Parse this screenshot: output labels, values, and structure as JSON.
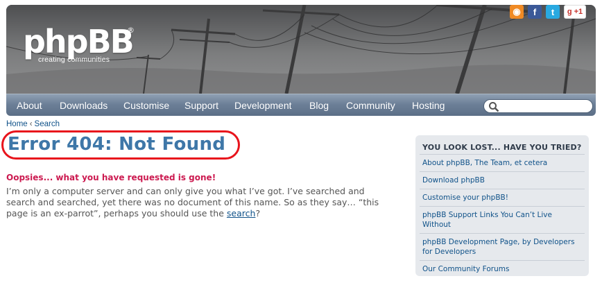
{
  "header": {
    "logo_text": "phpBB",
    "logo_reg": "®",
    "logo_tagline": "creating  communities",
    "social": [
      {
        "name": "rss-icon",
        "glyph": "◉"
      },
      {
        "name": "facebook-icon",
        "glyph": "f"
      },
      {
        "name": "twitter-icon",
        "glyph": "t"
      },
      {
        "name": "google-plus-icon",
        "glyph": "g +1"
      }
    ]
  },
  "nav": {
    "items": [
      "About",
      "Downloads",
      "Customise",
      "Support",
      "Development",
      "Blog",
      "Community",
      "Hosting"
    ],
    "search_placeholder": ""
  },
  "breadcrumb": {
    "home": "Home",
    "separator": "‹",
    "current": "Search"
  },
  "main": {
    "title": "Error 404: Not Found",
    "subhead": "Oopsies... what you have requested is gone!",
    "body_line1": "I’m only a computer server and can only give you what I’ve got. I’ve searched and",
    "body_line2": "search and searched, yet there was no document of this name. So as they say… “this",
    "body_line3_pre": "page is an ex-parrot”, perhaps you should use the ",
    "body_link": "search",
    "body_line3_post": "?"
  },
  "sidebar": {
    "title": "YOU LOOK LOST... HAVE YOU TRIED?",
    "links": [
      "About phpBB, The Team, et cetera",
      "Download phpBB",
      "Customise your phpBB!",
      "phpBB Support Links You Can’t Live Without",
      "phpBB Development Page, by Developers for Developers",
      "Our Community Forums"
    ]
  },
  "colors": {
    "title": "#3e77a8",
    "subhead": "#cc1a50",
    "link": "#105289",
    "annotation_ring": "#e8141c",
    "nav": "#6d8098"
  }
}
